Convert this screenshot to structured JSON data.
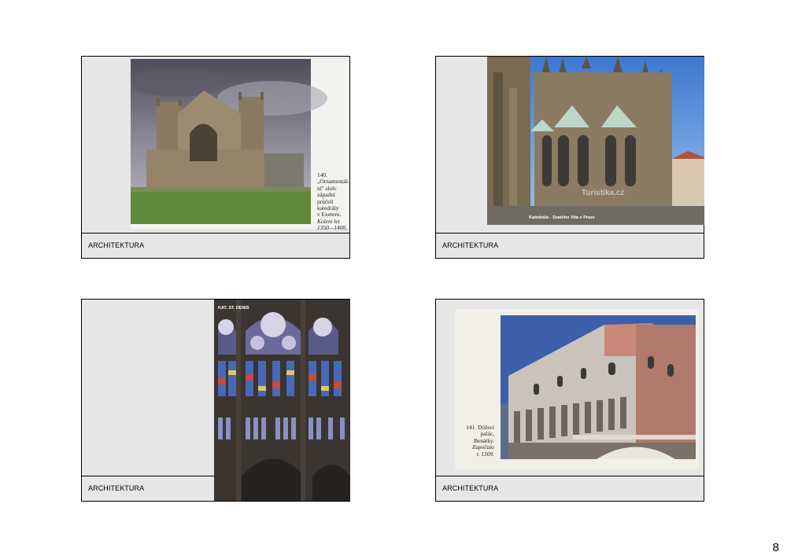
{
  "slides": [
    {
      "label": "ARCHITEKTURA",
      "caption": [
        "140.",
        "„Ornamentál-",
        "ní\" sloh:",
        "západní",
        "průčelí",
        "katedrály",
        "v Exeteru.",
        "Kolem let",
        "1350—1400."
      ]
    },
    {
      "label": "ARCHITEKTURA",
      "overlay": "Katedrála - Svatého Víta v Praze",
      "watermark": "Turistika.cz"
    },
    {
      "label": "ARCHITEKTURA",
      "overlay": "KAT. ST. DENIS"
    },
    {
      "label": "ARCHITEKTURA",
      "caption": [
        "141. Dóžecí",
        "palác,",
        "Benátky.",
        "Započato",
        "r. 1309."
      ]
    }
  ],
  "page_number": "8"
}
